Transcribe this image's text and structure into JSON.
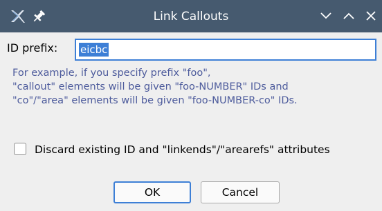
{
  "window": {
    "title": "Link Callouts",
    "accent": "#3d7fd6",
    "titlebar_color": "#465a6f"
  },
  "form": {
    "prefix_label": "ID prefix:",
    "prefix_value": "eicbc",
    "help_lines": [
      "For example, if you specify prefix \"foo\",",
      "\"callout\" elements will be given \"foo-NUMBER\" IDs and",
      "\"co\"/\"area\" elements will be given \"foo-NUMBER-co\" IDs."
    ],
    "discard_label": "Discard existing ID and \"linkends\"/\"arearefs\" attributes",
    "discard_checked": false
  },
  "buttons": {
    "ok": "OK",
    "cancel": "Cancel"
  }
}
